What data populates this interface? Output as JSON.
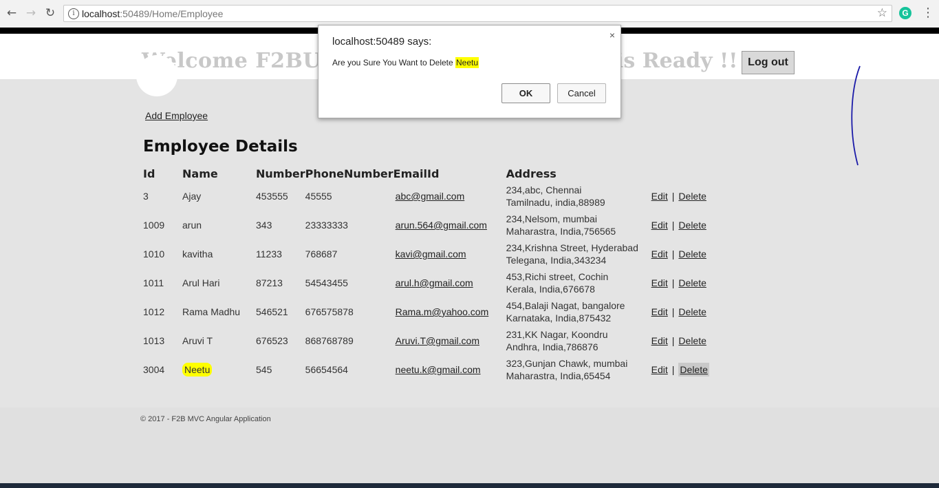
{
  "browser": {
    "url_host": "localhost",
    "url_rest": ":50489/Home/Employee",
    "extension_label": "G"
  },
  "header": {
    "welcome_text": "Welcome F2BUser",
    "welcome_tail": "is Ready !!",
    "logout_label": "Log out"
  },
  "add_employee_label": "Add Employee",
  "section_title": "Employee Details",
  "table": {
    "headers": [
      "Id",
      "Name",
      "Number",
      "PhoneNumber",
      "EmailId",
      "Address"
    ],
    "rows": [
      {
        "id": "3",
        "name": "Ajay",
        "number": "453555",
        "phone": "45555",
        "email": "abc@gmail.com",
        "address1": "234,abc, Chennai",
        "address2": "Tamilnadu, india,88989"
      },
      {
        "id": "1009",
        "name": "arun",
        "number": "343",
        "phone": "23333333",
        "email": "arun.564@gmail.com",
        "address1": "234,Nelsom, mumbai",
        "address2": "Maharastra, India,756565"
      },
      {
        "id": "1010",
        "name": "kavitha",
        "number": "11233",
        "phone": "768687",
        "email": "kavi@gmail.com",
        "address1": "234,Krishna Street, Hyderabad",
        "address2": "Telegana, India,343234"
      },
      {
        "id": "1011",
        "name": "Arul Hari",
        "number": "87213",
        "phone": "54543455",
        "email": "arul.h@gmail.com",
        "address1": "453,Richi street, Cochin",
        "address2": "Kerala, India,676678"
      },
      {
        "id": "1012",
        "name": "Rama Madhu",
        "number": "546521",
        "phone": "676575878",
        "email": "Rama.m@yahoo.com",
        "address1": "454,Balaji Nagat, bangalore",
        "address2": "Karnataka, India,875432"
      },
      {
        "id": "1013",
        "name": "Aruvi T",
        "number": "676523",
        "phone": "868768789",
        "email": "Aruvi.T@gmail.com",
        "address1": "231,KK Nagar, Koondru",
        "address2": "Andhra, India,786876"
      },
      {
        "id": "3004",
        "name": "Neetu",
        "number": "545",
        "phone": "56654564",
        "email": "neetu.k@gmail.com",
        "address1": "323,Gunjan Chawk, mumbai",
        "address2": "Maharastra, India,65454"
      }
    ],
    "edit_label": "Edit",
    "delete_label": "Delete",
    "separator": "|"
  },
  "footer": {
    "copyright": "© 2017 - F2B MVC Angular Application"
  },
  "dialog": {
    "title": "localhost:50489 says:",
    "message_prefix": "Are you Sure You Want to Delete",
    "message_name": "Neetu",
    "ok_label": "OK",
    "cancel_label": "Cancel",
    "close_glyph": "×"
  },
  "colors": {
    "highlight": "#ffff00",
    "welcome_text": "#c8c8c8",
    "page_background": "#e4e4e4",
    "pen_stroke": "#1a1aa8"
  }
}
